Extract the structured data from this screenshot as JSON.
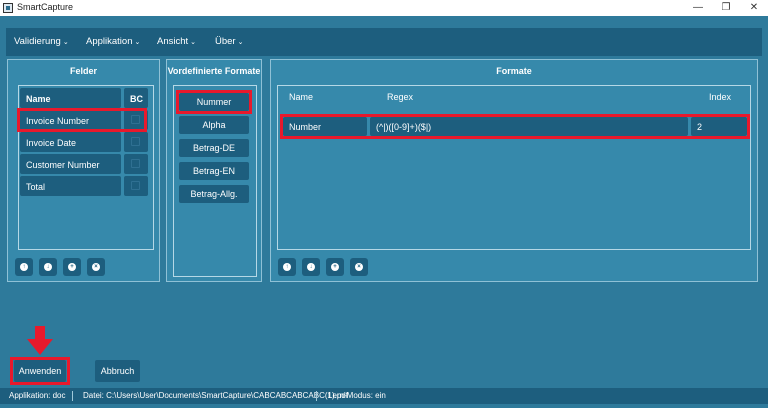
{
  "window": {
    "title": "SmartCapture",
    "minimize_glyph": "—",
    "maximize_glyph": "❐",
    "close_glyph": "✕"
  },
  "menu": {
    "items": [
      {
        "label": "Validierung"
      },
      {
        "label": "Applikation"
      },
      {
        "label": "Ansicht"
      },
      {
        "label": "Über"
      }
    ],
    "chevron": "⌄"
  },
  "felder": {
    "title": "Felder",
    "header_name": "Name",
    "header_bc": "BC",
    "rows": [
      {
        "name": "Invoice Number",
        "highlighted": true
      },
      {
        "name": "Invoice Date"
      },
      {
        "name": "Customer Number"
      },
      {
        "name": "Total"
      }
    ]
  },
  "vordefiniert": {
    "title": "Vordefinierte Formate",
    "buttons": [
      "Nummer",
      "Alpha",
      "Betrag-DE",
      "Betrag-EN",
      "Betrag-Allg."
    ]
  },
  "formate": {
    "title": "Formate",
    "col_name": "Name",
    "col_regex": "Regex",
    "col_index": "Index",
    "rows": [
      {
        "name": "Number",
        "regex": "(^|)([0-9]+)($|)",
        "index": "2"
      }
    ]
  },
  "small_buttons": {
    "icons": [
      "arrow-up-icon",
      "arrow-down-icon",
      "plus-icon",
      "close-icon"
    ],
    "glyphs": [
      "↑",
      "↓",
      "+",
      "×"
    ]
  },
  "actions": {
    "apply_label": "Anwenden",
    "cancel_label": "Abbruch"
  },
  "status": {
    "applikation": "Applikation: doc",
    "datei": "Datei: C:\\Users\\User\\Documents\\SmartCapture\\CABCABCABCABC(1).pdf",
    "lernmodus": "Lern-Modus: ein"
  },
  "colors": {
    "background": "#2e7a9b",
    "dark": "#1d5e7e",
    "highlight": "#e8192c"
  }
}
